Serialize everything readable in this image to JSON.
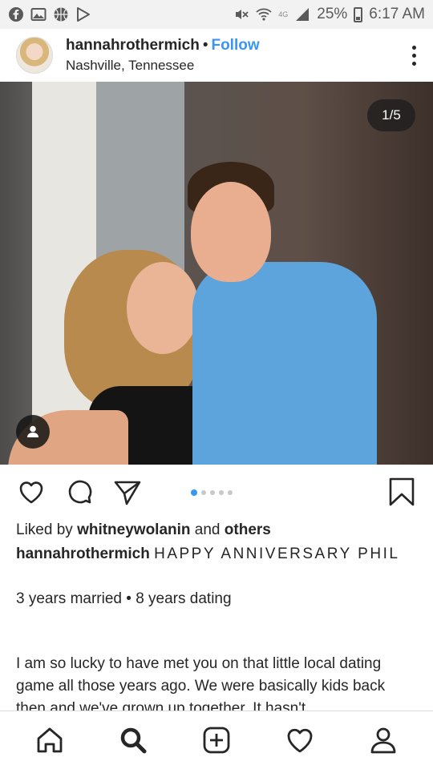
{
  "status_bar": {
    "network_label": "4G",
    "battery_percent": "25%",
    "time": "6:17 AM",
    "left_icons": [
      "facebook-icon",
      "gallery-icon",
      "basketball-icon",
      "play-store-icon"
    ],
    "right_icons": [
      "mute-icon",
      "wifi-icon",
      "signal-icon",
      "battery-icon"
    ]
  },
  "post": {
    "username": "hannahrothermich",
    "separator": "•",
    "follow_label": "Follow",
    "location": "Nashville, Tennessee",
    "carousel_counter": "1/5",
    "carousel_dots": 5,
    "carousel_active_index": 0
  },
  "likes": {
    "prefix": "Liked by",
    "user": "whitneywolanin",
    "middle": "and",
    "suffix": "others"
  },
  "caption": {
    "author": "hannahrothermich",
    "headline": "HAPPY ANNIVERSARY PHIL",
    "line2": "3 years married • 8 years dating",
    "paragraph": "I am so lucky to have met you on that little local dating game all those years ago. We were basically kids back then and we've grown up together. It hasn't"
  },
  "bottom_nav": [
    "home-icon",
    "search-icon",
    "new-post-icon",
    "activity-heart-icon",
    "profile-icon"
  ],
  "colors": {
    "accent": "#3897f0",
    "text": "#262626",
    "status_bg": "#f2f2f2"
  }
}
